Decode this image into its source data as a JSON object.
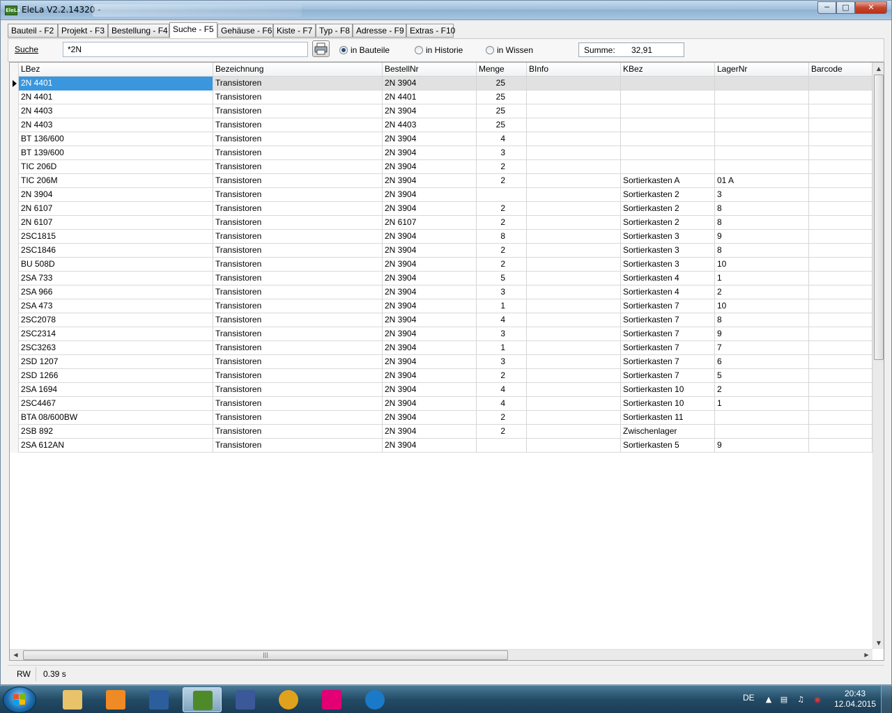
{
  "window": {
    "title": "EleLa V2.2.14320  -",
    "app_icon_text": "EleLa"
  },
  "tabs": [
    {
      "label": "Bauteil - F2"
    },
    {
      "label": "Projekt - F3"
    },
    {
      "label": "Bestellung - F4"
    },
    {
      "label": "Suche - F5",
      "active": true
    },
    {
      "label": "Gehäuse - F6"
    },
    {
      "label": "Kiste - F7"
    },
    {
      "label": "Typ - F8"
    },
    {
      "label": "Adresse - F9"
    },
    {
      "label": "Extras - F10"
    }
  ],
  "search": {
    "label": "Suche",
    "value": "*2N",
    "options": [
      {
        "label": "in Bauteile",
        "checked": true
      },
      {
        "label": "in Historie",
        "checked": false
      },
      {
        "label": "in Wissen",
        "checked": false
      }
    ],
    "summe_label": "Summe:",
    "summe_value": "32,91"
  },
  "grid": {
    "columns": [
      "LBez",
      "Bezeichnung",
      "BestellNr",
      "Menge",
      "BInfo",
      "KBez",
      "LagerNr",
      "Barcode"
    ],
    "rows": [
      [
        "2N 4401",
        "Transistoren",
        "2N 3904",
        "25",
        "",
        "",
        "",
        ""
      ],
      [
        "2N 4401",
        "Transistoren",
        "2N 4401",
        "25",
        "",
        "",
        "",
        ""
      ],
      [
        "2N 4403",
        "Transistoren",
        "2N 3904",
        "25",
        "",
        "",
        "",
        ""
      ],
      [
        "2N 4403",
        "Transistoren",
        "2N 4403",
        "25",
        "",
        "",
        "",
        ""
      ],
      [
        "BT 136/600",
        "Transistoren",
        "2N 3904",
        "4",
        "",
        "",
        "",
        ""
      ],
      [
        "BT 139/600",
        "Transistoren",
        "2N 3904",
        "3",
        "",
        "",
        "",
        ""
      ],
      [
        "TIC 206D",
        "Transistoren",
        "2N 3904",
        "2",
        "",
        "",
        "",
        ""
      ],
      [
        "TIC 206M",
        "Transistoren",
        "2N 3904",
        "2",
        "",
        "Sortierkasten A",
        "01 A",
        ""
      ],
      [
        "2N 3904",
        "Transistoren",
        "2N 3904",
        "",
        "",
        "Sortierkasten 2",
        "3",
        ""
      ],
      [
        "2N 6107",
        "Transistoren",
        "2N 3904",
        "2",
        "",
        "Sortierkasten 2",
        "8",
        ""
      ],
      [
        "2N 6107",
        "Transistoren",
        "2N 6107",
        "2",
        "",
        "Sortierkasten 2",
        "8",
        ""
      ],
      [
        "2SC1815",
        "Transistoren",
        "2N 3904",
        "8",
        "",
        "Sortierkasten 3",
        "9",
        ""
      ],
      [
        "2SC1846",
        "Transistoren",
        "2N 3904",
        "2",
        "",
        "Sortierkasten 3",
        "8",
        ""
      ],
      [
        "BU 508D",
        "Transistoren",
        "2N 3904",
        "2",
        "",
        "Sortierkasten 3",
        "10",
        ""
      ],
      [
        "2SA 733",
        "Transistoren",
        "2N 3904",
        "5",
        "",
        "Sortierkasten 4",
        "1",
        ""
      ],
      [
        "2SA 966",
        "Transistoren",
        "2N 3904",
        "3",
        "",
        "Sortierkasten 4",
        "2",
        ""
      ],
      [
        "2SA 473",
        "Transistoren",
        "2N 3904",
        "1",
        "",
        "Sortierkasten 7",
        "10",
        ""
      ],
      [
        "2SC2078",
        "Transistoren",
        "2N 3904",
        "4",
        "",
        "Sortierkasten 7",
        "8",
        ""
      ],
      [
        "2SC2314",
        "Transistoren",
        "2N 3904",
        "3",
        "",
        "Sortierkasten 7",
        "9",
        ""
      ],
      [
        "2SC3263",
        "Transistoren",
        "2N 3904",
        "1",
        "",
        "Sortierkasten 7",
        "7",
        ""
      ],
      [
        "2SD 1207",
        "Transistoren",
        "2N 3904",
        "3",
        "",
        "Sortierkasten 7",
        "6",
        ""
      ],
      [
        "2SD 1266",
        "Transistoren",
        "2N 3904",
        "2",
        "",
        "Sortierkasten 7",
        "5",
        ""
      ],
      [
        "2SA 1694",
        "Transistoren",
        "2N 3904",
        "4",
        "",
        "Sortierkasten 10",
        "2",
        ""
      ],
      [
        "2SC4467",
        "Transistoren",
        "2N 3904",
        "4",
        "",
        "Sortierkasten 10",
        "1",
        ""
      ],
      [
        "BTA 08/600BW",
        "Transistoren",
        "2N 3904",
        "2",
        "",
        "Sortierkasten 11",
        "",
        ""
      ],
      [
        "2SB 892",
        "Transistoren",
        "2N 3904",
        "2",
        "",
        "Zwischenlager",
        "",
        ""
      ],
      [
        "2SA 612AN",
        "Transistoren",
        "2N 3904",
        "",
        "",
        "Sortierkasten 5",
        "9",
        ""
      ]
    ],
    "selected_row": 0
  },
  "status": {
    "mode": "RW",
    "time": "0.39 s"
  },
  "taskbar": {
    "items": [
      {
        "name": "explorer",
        "color": "#e8c36a"
      },
      {
        "name": "media-player",
        "color": "#f08a24"
      },
      {
        "name": "chart-app",
        "color": "#2c5e9e"
      },
      {
        "name": "elela",
        "color": "#4f8a2a",
        "active": true
      },
      {
        "name": "facebook",
        "color": "#3b5998"
      },
      {
        "name": "chrome",
        "color": "#e0a21c"
      },
      {
        "name": "telekom",
        "color": "#e20074"
      },
      {
        "name": "maxthon",
        "color": "#1a7ac7"
      }
    ],
    "language": "DE",
    "time": "20:43",
    "date": "12.04.2015"
  }
}
